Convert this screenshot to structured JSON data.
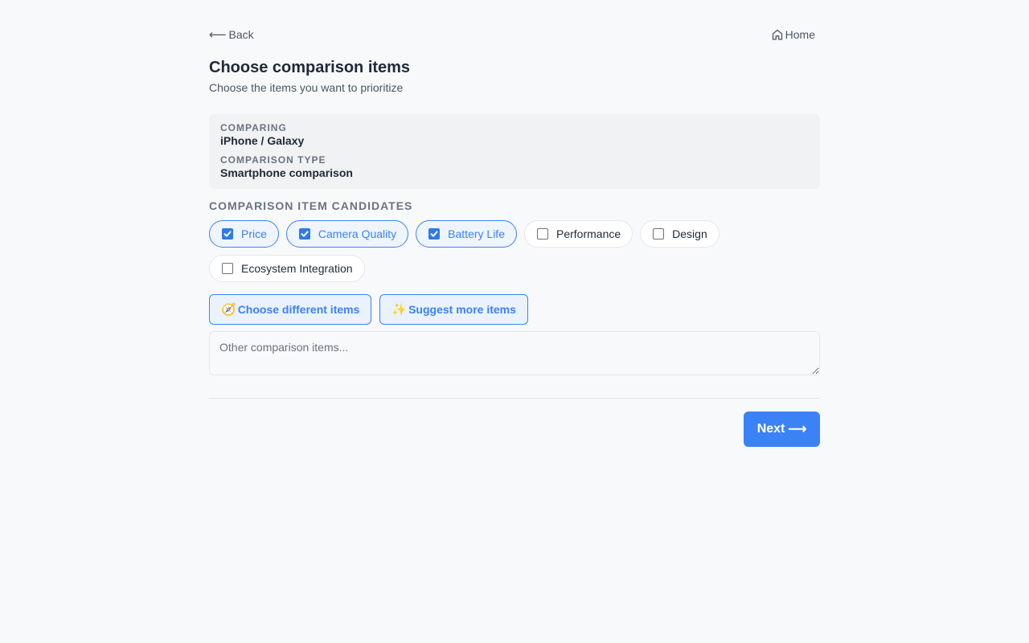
{
  "nav": {
    "back_label": "Back",
    "home_label": "Home"
  },
  "header": {
    "title": "Choose comparison items",
    "subtitle": "Choose the items you want to prioritize"
  },
  "info": {
    "comparing_label": "COMPARING",
    "comparing_value": "iPhone / Galaxy",
    "type_label": "COMPARISON TYPE",
    "type_value": "Smartphone comparison"
  },
  "candidates": {
    "section_label": "COMPARISON ITEM CANDIDATES",
    "items": [
      {
        "label": "Price",
        "checked": true
      },
      {
        "label": "Camera Quality",
        "checked": true
      },
      {
        "label": "Battery Life",
        "checked": true
      },
      {
        "label": "Performance",
        "checked": false
      },
      {
        "label": "Design",
        "checked": false
      },
      {
        "label": "Ecosystem Integration",
        "checked": false
      }
    ]
  },
  "actions": {
    "choose_different": {
      "emoji": "🧭",
      "label": "Choose different items"
    },
    "suggest_more": {
      "emoji": "✨",
      "label": "Suggest more items"
    }
  },
  "other_input": {
    "value": "",
    "placeholder": "Other comparison items..."
  },
  "footer": {
    "next_label": "Next"
  },
  "colors": {
    "accent": "#3b82f6",
    "background": "#f8f9fb",
    "card": "#f1f2f4"
  }
}
